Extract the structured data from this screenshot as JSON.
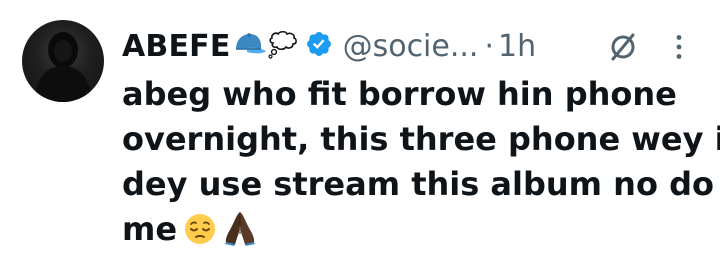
{
  "author": {
    "display_name": "ABEFE",
    "name_emojis": [
      "cap-emoji",
      "thought-bubble-emoji"
    ],
    "verified": true,
    "handle": "@socie...",
    "separator": "·",
    "time": "1h"
  },
  "tweet": {
    "lines": [
      "abeg who fit borrow hin phone",
      "overnight, this three phone wey i",
      "dey use stream this album no do",
      "me"
    ],
    "trailing_emojis": [
      "pensive-face-emoji",
      "folded-hands-emoji"
    ]
  },
  "colors": {
    "text": "#0f1419",
    "secondary": "#536471",
    "verified_blue": "#1d9bf0",
    "cap_blue": "#3b88c3"
  }
}
